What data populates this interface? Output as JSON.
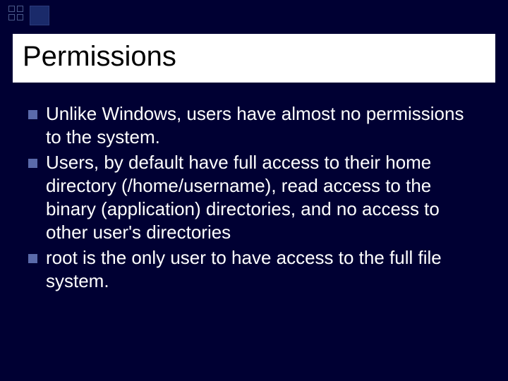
{
  "slide": {
    "title": "Permissions",
    "bullets": [
      "Unlike Windows, users have almost no permissions to the system.",
      "Users, by default have full access to their home directory (/home/username), read access to the binary (application) directories, and no access to other user's directories",
      "root is the only user to have access to the full file system."
    ]
  }
}
